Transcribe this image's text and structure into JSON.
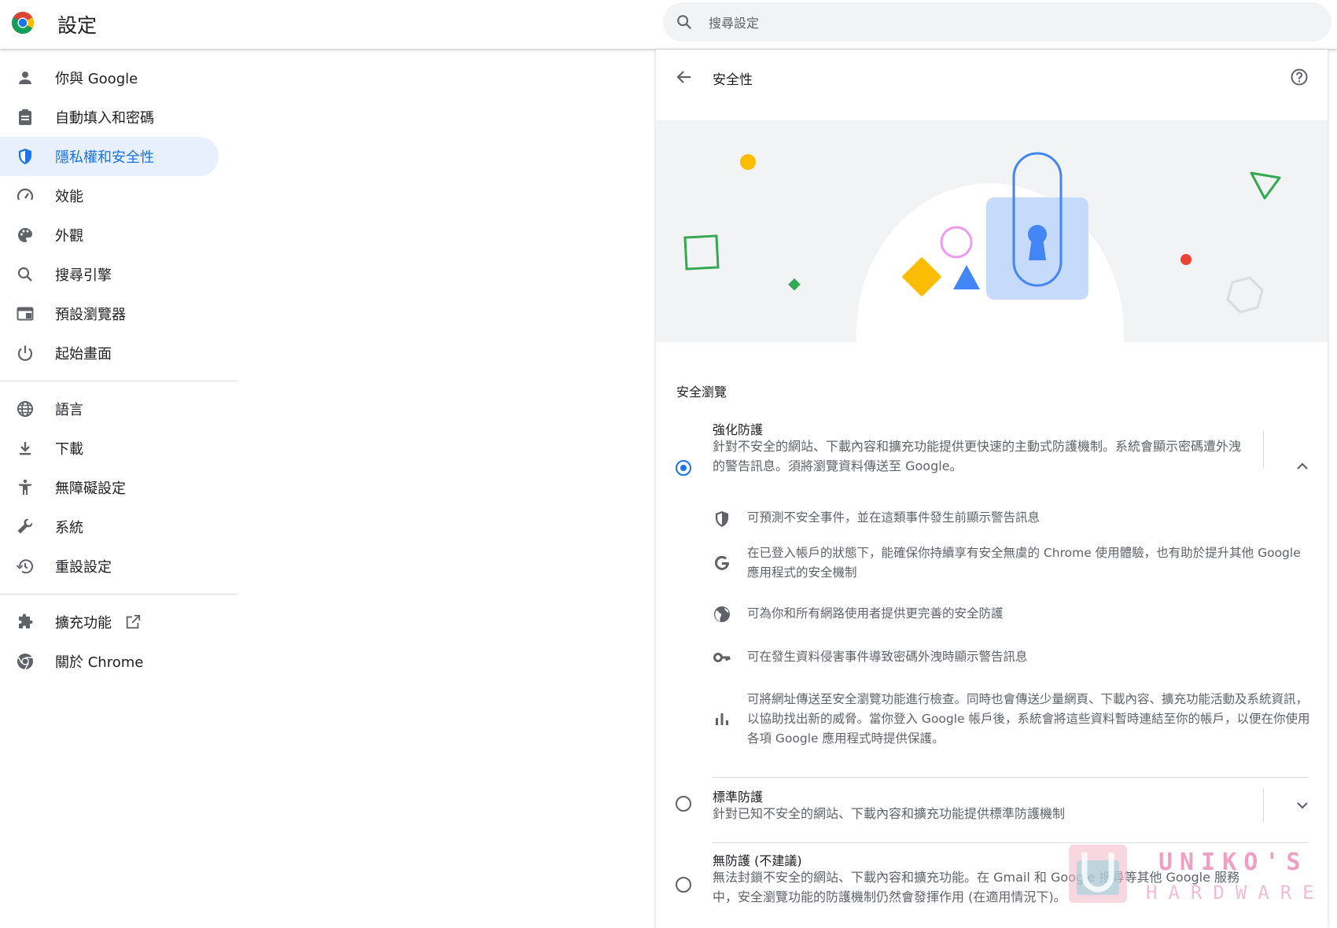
{
  "header": {
    "title": "設定",
    "search_placeholder": "搜尋設定",
    "logo_icon": "chrome-logo-icon"
  },
  "sidebar": {
    "items": [
      {
        "label": "你與 Google",
        "icon": "person-icon"
      },
      {
        "label": "自動填入和密碼",
        "icon": "clipboard-icon"
      },
      {
        "label": "隱私權和安全性",
        "icon": "shield-icon",
        "active": true
      },
      {
        "label": "效能",
        "icon": "speedometer-icon"
      },
      {
        "label": "外觀",
        "icon": "palette-icon"
      },
      {
        "label": "搜尋引擎",
        "icon": "search-icon"
      },
      {
        "label": "預設瀏覽器",
        "icon": "browser-window-icon"
      },
      {
        "label": "起始畫面",
        "icon": "power-icon"
      },
      {
        "label": "語言",
        "icon": "globe-icon"
      },
      {
        "label": "下載",
        "icon": "download-icon"
      },
      {
        "label": "無障礙設定",
        "icon": "accessibility-icon"
      },
      {
        "label": "系統",
        "icon": "wrench-icon"
      },
      {
        "label": "重設設定",
        "icon": "history-icon"
      },
      {
        "label": "擴充功能",
        "icon": "puzzle-icon"
      },
      {
        "label": "關於 Chrome",
        "icon": "chrome-icon"
      }
    ]
  },
  "page": {
    "title": "安全性",
    "section_label": "安全瀏覽"
  },
  "options": {
    "enhanced": {
      "title": "強化防護",
      "desc": "針對不安全的網站、下載內容和擴充功能提供更快速的主動式防護機制。系統會顯示密碼遭外洩的警告訊息。須將瀏覽資料傳送至 Google。",
      "selected": true,
      "features": [
        {
          "icon": "shield-icon",
          "text": "可預測不安全事件，並在這類事件發生前顯示警告訊息"
        },
        {
          "icon": "google-g-icon",
          "text": "在已登入帳戶的狀態下，能確保你持續享有安全無虞的 Chrome 使用體驗，也有助於提升其他 Google 應用程式的安全機制"
        },
        {
          "icon": "globe-icon",
          "text": "可為你和所有網路使用者提供更完善的安全防護"
        },
        {
          "icon": "key-icon",
          "text": "可在發生資料侵害事件導致密碼外洩時顯示警告訊息"
        },
        {
          "icon": "bar-chart-icon",
          "text": "可將網址傳送至安全瀏覽功能進行檢查。同時也會傳送少量網頁、下載內容、擴充功能活動及系統資訊，以協助找出新的威脅。當你登入 Google 帳戶後，系統會將這些資料暫時連結至你的帳戶，以便在你使用各項 Google 應用程式時提供保護。"
        }
      ]
    },
    "standard": {
      "title": "標準防護",
      "desc": "針對已知不安全的網站、下載內容和擴充功能提供標準防護機制"
    },
    "none": {
      "title": "無防護 (不建議)",
      "desc": "無法封鎖不安全的網站、下載內容和擴充功能。在 Gmail 和 Google 搜尋等其他 Google 服務中，安全瀏覽功能的防護機制仍然會發揮作用 (在適用情況下)。"
    }
  },
  "watermark": {
    "line1": "UNIKO'S",
    "line2": "HARDWARE"
  },
  "colors": {
    "accent": "#1a73e8",
    "active_bg": "#e8f0fe",
    "text": "#202124",
    "secondary_text": "#5f6368"
  }
}
